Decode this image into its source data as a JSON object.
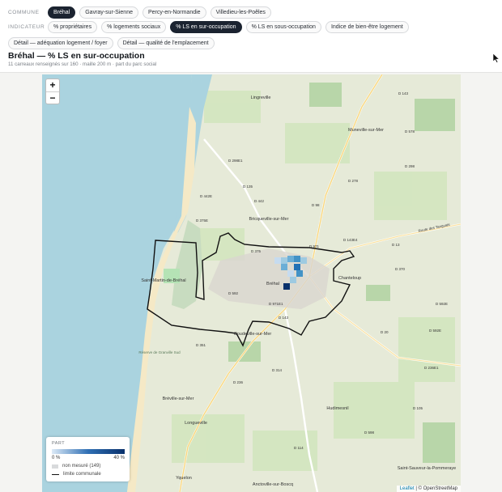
{
  "toolbar": {
    "commune_label": "COMMUNE",
    "communes": [
      "Bréhal",
      "Gavray-sur-Sienne",
      "Percy-en-Normandie",
      "Villedieu-les-Poêles"
    ],
    "commune_active": "Bréhal",
    "indicator_label": "INDICATEUR",
    "indicators": [
      "% propriétaires",
      "% logements sociaux",
      "% LS en sur-occupation",
      "% LS en sous-occupation",
      "Indice de bien-être logement",
      "Détail — adéquation logement / foyer",
      "Détail — qualité de l'emplacement"
    ],
    "indicator_active": "% LS en sur-occupation"
  },
  "header": {
    "title": "Bréhal — % LS en sur-occupation",
    "subtitle": "11 carreaux renseignés sur 160 · maille 200 m · part du parc social"
  },
  "map": {
    "zoom_in": "+",
    "zoom_out": "−",
    "places": [
      "Lingreville",
      "Muneville-sur-Mer",
      "Bricqueville-sur-Mer",
      "Saint-Martin-de-Bréhal",
      "Bréhal",
      "Chanteloup",
      "Coudeville-sur-Mer",
      "Bréville-sur-Mer",
      "Longueville",
      "Hudimesnil",
      "Anctoville-sur-Boscq",
      "Yquelon",
      "Saint-Sauveur-la-Pommeraye",
      "Réserve de Granville Sud"
    ],
    "roads": [
      "D 143",
      "D 578",
      "D 298",
      "D 298E1",
      "D 135",
      "D 442",
      "D 442E",
      "D 98",
      "D 278",
      "D 375E",
      "D 375",
      "D 971",
      "D 143E4",
      "D 13",
      "D 370",
      "D 592",
      "D 971E1",
      "D 351",
      "D 20",
      "D 592E",
      "D 314",
      "D 236E1",
      "D 236",
      "D 105",
      "D 598",
      "D 114"
    ],
    "route_label": "Route des Tanguais",
    "attribution_leaflet": "Leaflet",
    "attribution_rest": "| © OpenStreetMap"
  },
  "legend": {
    "title": "PART",
    "min": "0 %",
    "max": "40 %",
    "not_measured": "non mesuré (149)",
    "boundary": "limite communale"
  },
  "colors": {
    "active_chip": "#1b2330",
    "scale_low": "#dceaf7",
    "scale_high": "#08306b",
    "sea": "#aad3df",
    "boundary": "#111111"
  },
  "cells": {
    "measured": [
      {
        "value": 8
      },
      {
        "value": 12
      },
      {
        "value": 22
      },
      {
        "value": 30
      },
      {
        "value": 15
      },
      {
        "value": 18
      },
      {
        "value": 25
      },
      {
        "value": 10
      },
      {
        "value": 38
      },
      {
        "value": 14
      },
      {
        "value": 20
      }
    ]
  }
}
